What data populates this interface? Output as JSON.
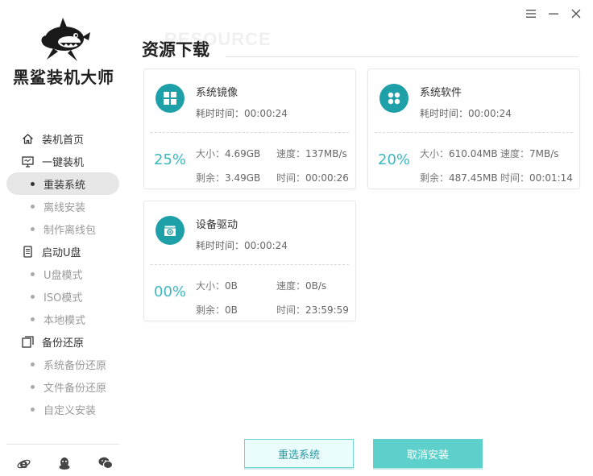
{
  "window": {
    "controls": [
      "menu-icon",
      "minimize-icon",
      "close-icon"
    ]
  },
  "sidebar": {
    "logo_text": "黑鲨装机大师",
    "nav": [
      {
        "label": "装机首页",
        "icon": "home-icon"
      },
      {
        "label": "一键装机",
        "icon": "monitor-icon",
        "children": [
          {
            "label": "重装系统",
            "active": true
          },
          {
            "label": "离线安装"
          },
          {
            "label": "制作离线包"
          }
        ]
      },
      {
        "label": "启动U盘",
        "icon": "usb-icon",
        "children": [
          {
            "label": "U盘模式"
          },
          {
            "label": "ISO模式"
          },
          {
            "label": "本地模式"
          }
        ]
      },
      {
        "label": "备份还原",
        "icon": "backup-icon",
        "children": [
          {
            "label": "系统备份还原"
          },
          {
            "label": "文件备份还原"
          },
          {
            "label": "自定义安装"
          }
        ]
      }
    ],
    "footer_icons": [
      "ie-icon",
      "qq-icon",
      "wechat-icon"
    ]
  },
  "header": {
    "watermark": "RESOURCE",
    "title": "资源下载"
  },
  "cards": [
    {
      "name": "系统镜像",
      "icon": "windows-icon",
      "elapsed_label": "耗时时间：",
      "elapsed": "00:00:24",
      "percent": "25%",
      "size_label": "大小：",
      "size": "4.69GB",
      "speed_label": "速度：",
      "speed": "137MB/s",
      "remain_label": "剩余：",
      "remain": "3.49GB",
      "time_label": "时间：",
      "time": "00:00:26"
    },
    {
      "name": "系统软件",
      "icon": "apps-icon",
      "elapsed_label": "耗时时间：",
      "elapsed": "00:00:24",
      "percent": "20%",
      "size_label": "大小：",
      "size": "610.04MB",
      "speed_label": "速度：",
      "speed": "7MB/s",
      "remain_label": "剩余：",
      "remain": "487.45MB",
      "time_label": "时间：",
      "time": "00:01:14"
    },
    {
      "name": "设备驱动",
      "icon": "driver-icon",
      "elapsed_label": "耗时时间：",
      "elapsed": "00:00:24",
      "percent": "00%",
      "size_label": "大小：",
      "size": "0B",
      "speed_label": "速度：",
      "speed": "0B/s",
      "remain_label": "剩余：",
      "remain": "0B",
      "time_label": "时间：",
      "time": "23:59:59"
    }
  ],
  "buttons": {
    "reselect": "重选系统",
    "cancel": "取消安装"
  },
  "colors": {
    "accent": "#1ea0a8",
    "percent": "#39b8c0",
    "cancel_bg": "#5ed0cb"
  }
}
